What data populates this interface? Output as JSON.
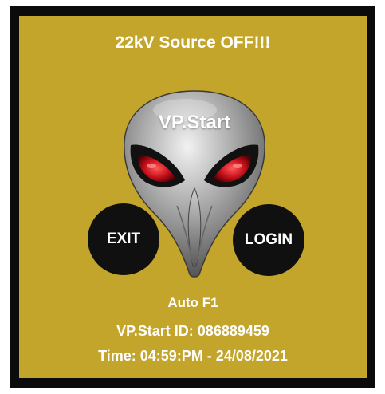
{
  "screen": {
    "alert_text": "22kV Source OFF!!!",
    "logo_title": "VP.Start",
    "mode_text": "Auto F1",
    "device_id_text": "VP.Start ID: 086889459",
    "time_text": "Time: 04:59:PM - 24/08/2021"
  },
  "buttons": {
    "exit_label": "EXIT",
    "login_label": "LOGIN"
  },
  "colors": {
    "panel_background": "#c4a52c",
    "frame_border": "#0b0b0b",
    "button_fill": "#101010",
    "mascot_eye": "#c8101a",
    "text": "#ffffff"
  },
  "icons": {
    "mascot": "alien-head-icon"
  }
}
